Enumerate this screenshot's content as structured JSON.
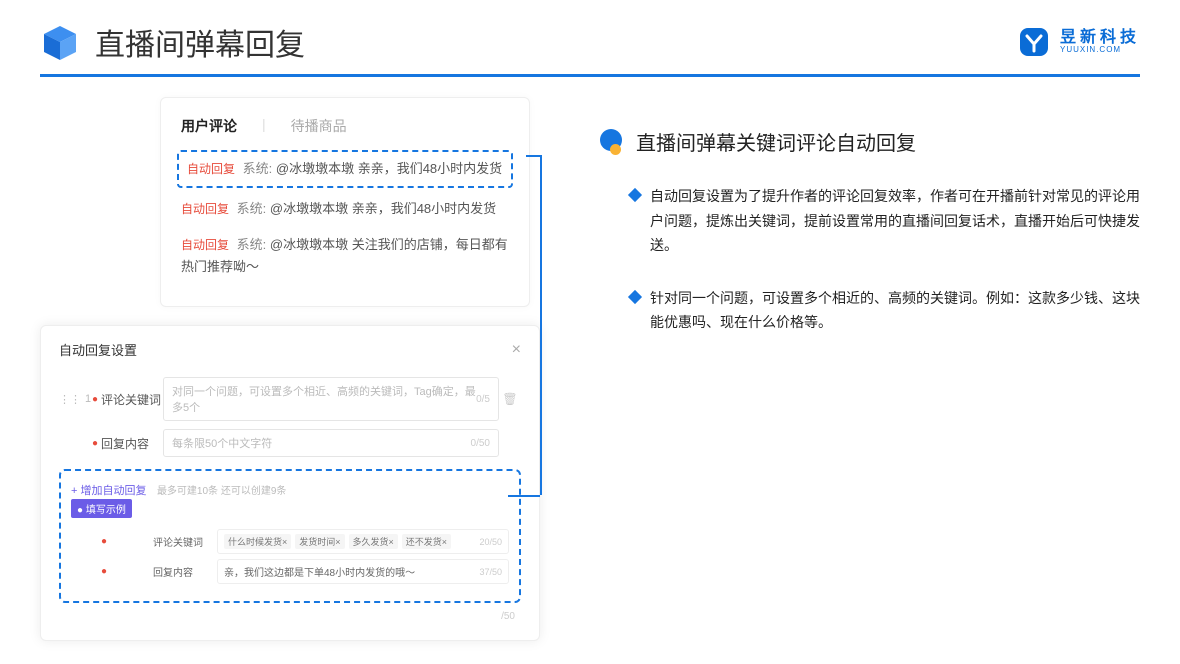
{
  "header": {
    "title": "直播间弹幕回复",
    "brand_name": "昱新科技",
    "brand_sub": "YUUXIN.COM"
  },
  "comments": {
    "tab_active": "用户评论",
    "tab_inactive": "待播商品",
    "items": [
      {
        "auto": "自动回复",
        "sys": "系统:",
        "text": "@冰墩墩本墩 亲亲，我们48小时内发货",
        "highlight": true
      },
      {
        "auto": "自动回复",
        "sys": "系统:",
        "text": "@冰墩墩本墩 亲亲，我们48小时内发货",
        "highlight": false
      },
      {
        "auto": "自动回复",
        "sys": "系统:",
        "text": "@冰墩墩本墩 关注我们的店铺，每日都有热门推荐呦～",
        "highlight": false
      }
    ]
  },
  "settings": {
    "title": "自动回复设置",
    "index": "1",
    "kw_label": "评论关键词",
    "kw_placeholder": "对同一个问题，可设置多个相近、高频的关键词，Tag确定，最多5个",
    "kw_counter": "0/5",
    "content_label": "回复内容",
    "content_placeholder": "每条限50个中文字符",
    "content_counter": "0/50",
    "add_label": "+ 增加自动回复",
    "add_sub": "最多可建10条 还可以创建9条",
    "example_badge": "● 填写示例",
    "ex_kw_label": "评论关键词",
    "ex_tags": [
      "什么时候发货×",
      "发货时间×",
      "多久发货×",
      "还不发货×"
    ],
    "ex_kw_counter": "20/50",
    "ex_content_label": "回复内容",
    "ex_content_text": "亲，我们这边都是下单48小时内发货的哦～",
    "ex_content_counter": "37/50",
    "bottom_counter": "/50"
  },
  "right": {
    "section_title": "直播间弹幕关键词评论自动回复",
    "bullets": [
      "自动回复设置为了提升作者的评论回复效率，作者可在开播前针对常见的评论用户问题，提炼出关键词，提前设置常用的直播间回复话术，直播开始后可快捷发送。",
      "针对同一个问题，可设置多个相近的、高频的关键词。例如：这款多少钱、这块能优惠吗、现在什么价格等。"
    ]
  }
}
